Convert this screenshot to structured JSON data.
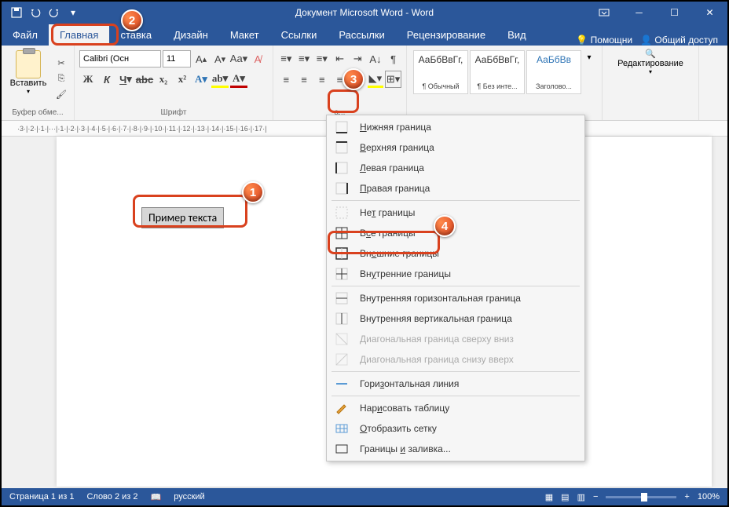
{
  "title": "Документ Microsoft Word - Word",
  "tabs": {
    "file": "Файл",
    "home": "Главная",
    "insert": "ставка",
    "design": "Дизайн",
    "layout": "Макет",
    "references": "Ссылки",
    "mailings": "Рассылки",
    "review": "Рецензирование",
    "view": "Вид",
    "help": "Помощни",
    "share": "Общий доступ"
  },
  "ribbon": {
    "clipboard": {
      "paste": "Вставить",
      "label": "Буфер обме..."
    },
    "font": {
      "name": "Calibri (Осн",
      "size": "11",
      "label": "Шрифт"
    },
    "paragraph": {
      "label": "а..."
    },
    "styles": {
      "s1": "АаБбВвГг,",
      "s1n": "¶ Обычный",
      "s2": "АаБбВвГг,",
      "s2n": "¶ Без инте...",
      "s3": "АаБбВв",
      "s3n": "Заголово..."
    },
    "editing": {
      "label": "Редактирование"
    }
  },
  "ruler": "·3·|·2·|·1·|···|·1·|·2·|·3·|·4·|·5·|·6·|·7·|·8·|·9·|·10·|·11·|·12·|·13·|·14·|·15·|·16·|·17·|",
  "sample": "Пример текста",
  "dropdown": {
    "bottom": "Нижняя граница",
    "top": "Верхняя граница",
    "left": "Левая граница",
    "right": "Правая граница",
    "none": "Нет границы",
    "all": "Все границы",
    "outer": "Внешние границы",
    "inner": "Внутренние границы",
    "hinner": "Внутренняя горизонтальная граница",
    "vinner": "Внутренняя вертикальная граница",
    "ddown": "Диагональная граница сверху вниз",
    "dup": "Диагональная граница снизу вверх",
    "hline": "Горизонтальная линия",
    "draw": "Нарисовать таблицу",
    "grid": "Отобразить сетку",
    "more": "Границы и заливка..."
  },
  "status": {
    "page": "Страница 1 из 1",
    "words": "Слово 2 из 2",
    "lang": "русский",
    "zoom": "100%"
  },
  "callouts": {
    "c1": "1",
    "c2": "2",
    "c3": "3",
    "c4": "4"
  }
}
